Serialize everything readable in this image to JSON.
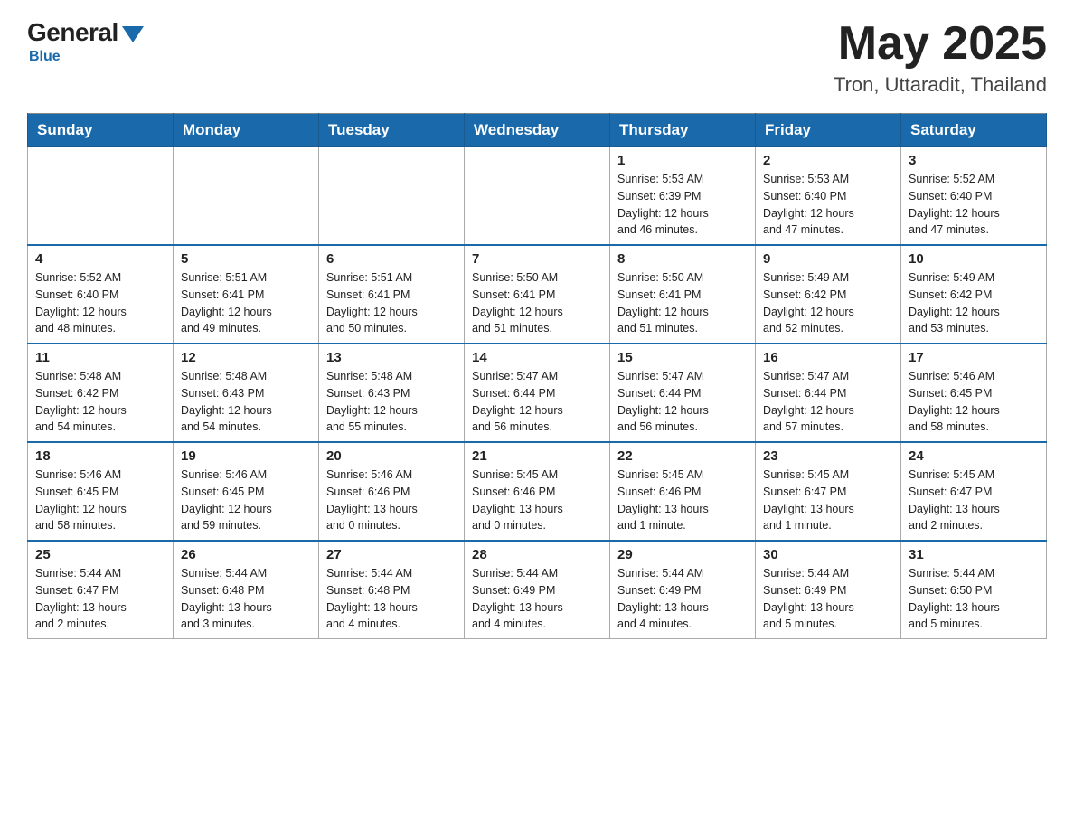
{
  "header": {
    "logo": {
      "general": "General",
      "blue": "Blue",
      "subtitle": "Blue"
    },
    "month_year": "May 2025",
    "location": "Tron, Uttaradit, Thailand"
  },
  "days_of_week": [
    "Sunday",
    "Monday",
    "Tuesday",
    "Wednesday",
    "Thursday",
    "Friday",
    "Saturday"
  ],
  "weeks": [
    [
      {
        "day": "",
        "info": ""
      },
      {
        "day": "",
        "info": ""
      },
      {
        "day": "",
        "info": ""
      },
      {
        "day": "",
        "info": ""
      },
      {
        "day": "1",
        "info": "Sunrise: 5:53 AM\nSunset: 6:39 PM\nDaylight: 12 hours\nand 46 minutes."
      },
      {
        "day": "2",
        "info": "Sunrise: 5:53 AM\nSunset: 6:40 PM\nDaylight: 12 hours\nand 47 minutes."
      },
      {
        "day": "3",
        "info": "Sunrise: 5:52 AM\nSunset: 6:40 PM\nDaylight: 12 hours\nand 47 minutes."
      }
    ],
    [
      {
        "day": "4",
        "info": "Sunrise: 5:52 AM\nSunset: 6:40 PM\nDaylight: 12 hours\nand 48 minutes."
      },
      {
        "day": "5",
        "info": "Sunrise: 5:51 AM\nSunset: 6:41 PM\nDaylight: 12 hours\nand 49 minutes."
      },
      {
        "day": "6",
        "info": "Sunrise: 5:51 AM\nSunset: 6:41 PM\nDaylight: 12 hours\nand 50 minutes."
      },
      {
        "day": "7",
        "info": "Sunrise: 5:50 AM\nSunset: 6:41 PM\nDaylight: 12 hours\nand 51 minutes."
      },
      {
        "day": "8",
        "info": "Sunrise: 5:50 AM\nSunset: 6:41 PM\nDaylight: 12 hours\nand 51 minutes."
      },
      {
        "day": "9",
        "info": "Sunrise: 5:49 AM\nSunset: 6:42 PM\nDaylight: 12 hours\nand 52 minutes."
      },
      {
        "day": "10",
        "info": "Sunrise: 5:49 AM\nSunset: 6:42 PM\nDaylight: 12 hours\nand 53 minutes."
      }
    ],
    [
      {
        "day": "11",
        "info": "Sunrise: 5:48 AM\nSunset: 6:42 PM\nDaylight: 12 hours\nand 54 minutes."
      },
      {
        "day": "12",
        "info": "Sunrise: 5:48 AM\nSunset: 6:43 PM\nDaylight: 12 hours\nand 54 minutes."
      },
      {
        "day": "13",
        "info": "Sunrise: 5:48 AM\nSunset: 6:43 PM\nDaylight: 12 hours\nand 55 minutes."
      },
      {
        "day": "14",
        "info": "Sunrise: 5:47 AM\nSunset: 6:44 PM\nDaylight: 12 hours\nand 56 minutes."
      },
      {
        "day": "15",
        "info": "Sunrise: 5:47 AM\nSunset: 6:44 PM\nDaylight: 12 hours\nand 56 minutes."
      },
      {
        "day": "16",
        "info": "Sunrise: 5:47 AM\nSunset: 6:44 PM\nDaylight: 12 hours\nand 57 minutes."
      },
      {
        "day": "17",
        "info": "Sunrise: 5:46 AM\nSunset: 6:45 PM\nDaylight: 12 hours\nand 58 minutes."
      }
    ],
    [
      {
        "day": "18",
        "info": "Sunrise: 5:46 AM\nSunset: 6:45 PM\nDaylight: 12 hours\nand 58 minutes."
      },
      {
        "day": "19",
        "info": "Sunrise: 5:46 AM\nSunset: 6:45 PM\nDaylight: 12 hours\nand 59 minutes."
      },
      {
        "day": "20",
        "info": "Sunrise: 5:46 AM\nSunset: 6:46 PM\nDaylight: 13 hours\nand 0 minutes."
      },
      {
        "day": "21",
        "info": "Sunrise: 5:45 AM\nSunset: 6:46 PM\nDaylight: 13 hours\nand 0 minutes."
      },
      {
        "day": "22",
        "info": "Sunrise: 5:45 AM\nSunset: 6:46 PM\nDaylight: 13 hours\nand 1 minute."
      },
      {
        "day": "23",
        "info": "Sunrise: 5:45 AM\nSunset: 6:47 PM\nDaylight: 13 hours\nand 1 minute."
      },
      {
        "day": "24",
        "info": "Sunrise: 5:45 AM\nSunset: 6:47 PM\nDaylight: 13 hours\nand 2 minutes."
      }
    ],
    [
      {
        "day": "25",
        "info": "Sunrise: 5:44 AM\nSunset: 6:47 PM\nDaylight: 13 hours\nand 2 minutes."
      },
      {
        "day": "26",
        "info": "Sunrise: 5:44 AM\nSunset: 6:48 PM\nDaylight: 13 hours\nand 3 minutes."
      },
      {
        "day": "27",
        "info": "Sunrise: 5:44 AM\nSunset: 6:48 PM\nDaylight: 13 hours\nand 4 minutes."
      },
      {
        "day": "28",
        "info": "Sunrise: 5:44 AM\nSunset: 6:49 PM\nDaylight: 13 hours\nand 4 minutes."
      },
      {
        "day": "29",
        "info": "Sunrise: 5:44 AM\nSunset: 6:49 PM\nDaylight: 13 hours\nand 4 minutes."
      },
      {
        "day": "30",
        "info": "Sunrise: 5:44 AM\nSunset: 6:49 PM\nDaylight: 13 hours\nand 5 minutes."
      },
      {
        "day": "31",
        "info": "Sunrise: 5:44 AM\nSunset: 6:50 PM\nDaylight: 13 hours\nand 5 minutes."
      }
    ]
  ]
}
